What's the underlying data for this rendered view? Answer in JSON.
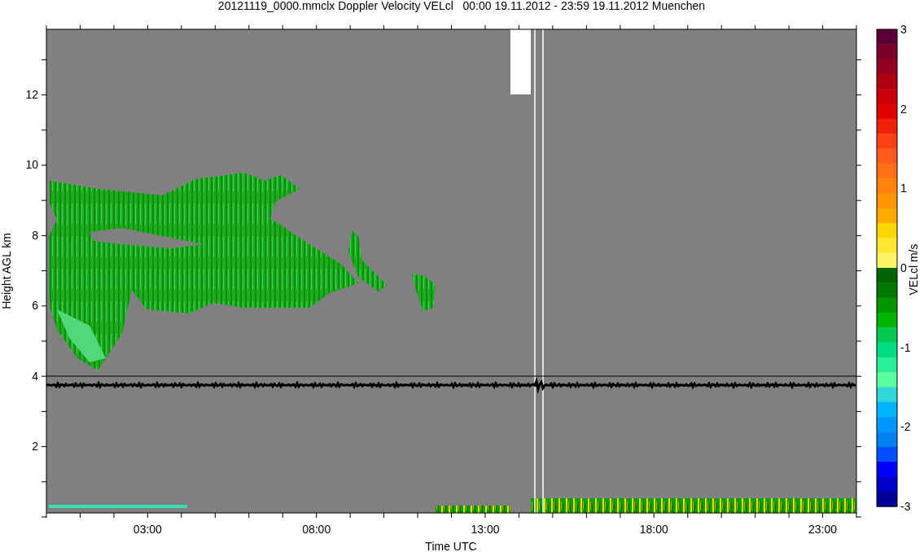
{
  "title": "20121119_0000.mmclx Doppler Velocity VELcl   00:00 19.11.2012 - 23:59 19.11.2012 Muenchen",
  "plot": {
    "ylabel": "Height AGL km",
    "yticks": [
      "12",
      "10",
      "8",
      "6",
      "4",
      "2"
    ],
    "xlabel": "Time UTC",
    "xticks": [
      "03:00",
      "08:00",
      "13:00",
      "18:00",
      "23:00"
    ]
  },
  "colorbar": {
    "label": "VELcl m/s",
    "ticks": [
      "3",
      "2",
      "1",
      "0",
      "-1",
      "-2",
      "-3"
    ],
    "segments": [
      {
        "color": "#5a0036"
      },
      {
        "color": "#78002a"
      },
      {
        "color": "#930020"
      },
      {
        "color": "#b00010"
      },
      {
        "color": "#c80008"
      },
      {
        "color": "#e00000"
      },
      {
        "color": "#f0200a"
      },
      {
        "color": "#fa4014"
      },
      {
        "color": "#ff5a1e"
      },
      {
        "color": "#ff7014"
      },
      {
        "color": "#ff820a"
      },
      {
        "color": "#ff9600"
      },
      {
        "color": "#ffaa00"
      },
      {
        "color": "#ffd700"
      },
      {
        "color": "#ffe632"
      },
      {
        "color": "#fff564"
      },
      {
        "color": "#006400"
      },
      {
        "color": "#007800"
      },
      {
        "color": "#009600"
      },
      {
        "color": "#00b400"
      },
      {
        "color": "#00c850"
      },
      {
        "color": "#00dc82"
      },
      {
        "color": "#28f096"
      },
      {
        "color": "#5affa0"
      },
      {
        "color": "#32d7d7"
      },
      {
        "color": "#00b4ff"
      },
      {
        "color": "#0096ff"
      },
      {
        "color": "#0082f0"
      },
      {
        "color": "#0050ff"
      },
      {
        "color": "#0000ff"
      },
      {
        "color": "#0000c8"
      },
      {
        "color": "#000096"
      }
    ]
  }
}
